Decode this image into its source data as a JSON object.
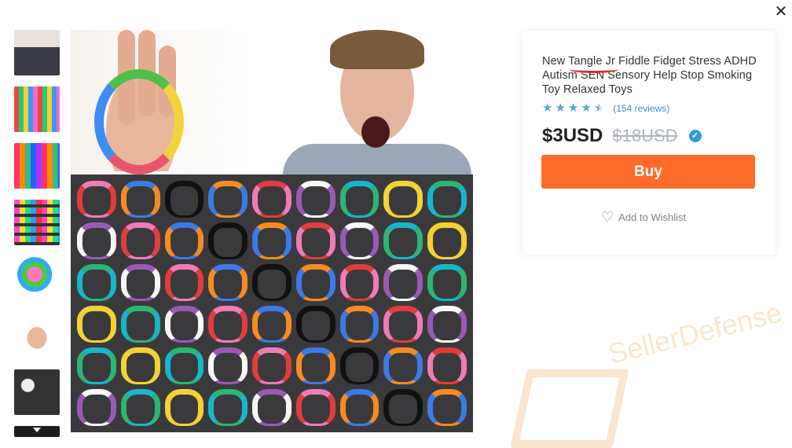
{
  "close": {
    "icon": "close-icon",
    "glyph": "✕"
  },
  "thumbnails": [
    {
      "name": "thumb-1"
    },
    {
      "name": "thumb-2"
    },
    {
      "name": "thumb-3"
    },
    {
      "name": "thumb-4"
    },
    {
      "name": "thumb-5"
    },
    {
      "name": "thumb-6"
    },
    {
      "name": "thumb-7"
    }
  ],
  "thumbnail_scroll": {
    "icon": "chevron-down-icon"
  },
  "product": {
    "title": "New Tangle Jr Fiddle Fidget Stress ADHD Autism SEN Sensory Help Stop Smoking Toy Relaxed Toys",
    "rating": {
      "stars": 4.5,
      "max": 5,
      "reviews_label": "(154 reviews)"
    },
    "price_now": "$3USD",
    "price_old": "$18USD",
    "buy_label": "Buy",
    "wishlist_label": "Add to Wishlist"
  },
  "watermark": {
    "text": "SellerDefense"
  },
  "colors": {
    "accent": "#fe6b2a",
    "star": "#52a8d6",
    "link": "#3a8fd1",
    "verified": "#2f9bd8",
    "annotation_red": "#e3262f"
  }
}
